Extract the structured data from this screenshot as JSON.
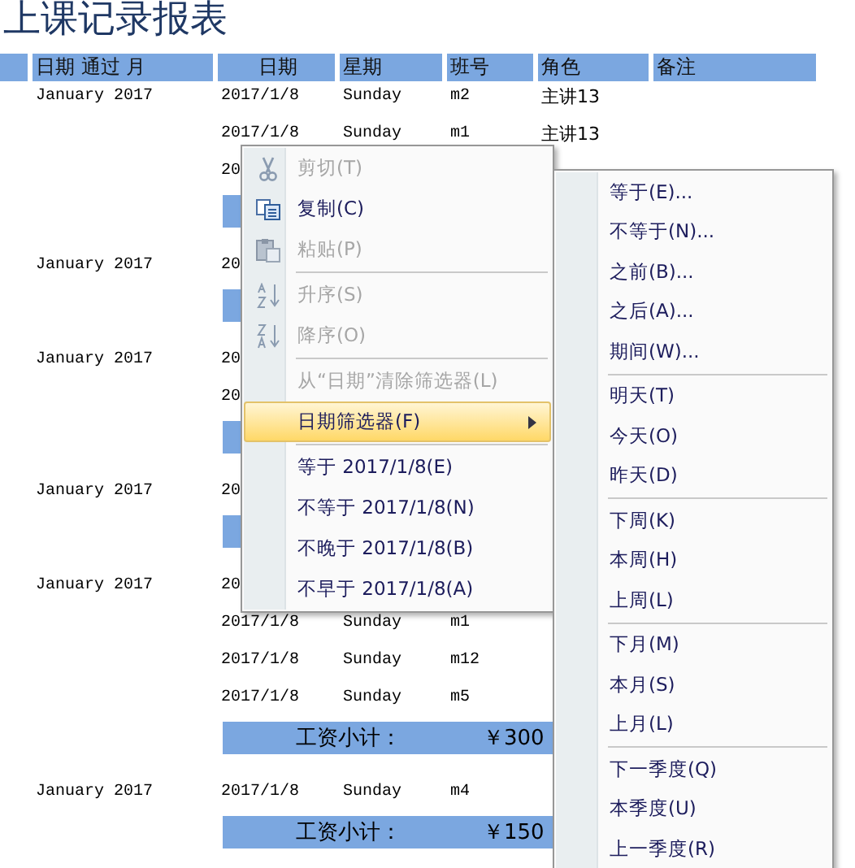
{
  "title": "上课记录报表",
  "columns": [
    {
      "label": "日期 通过 月"
    },
    {
      "label": "日期"
    },
    {
      "label": "星期"
    },
    {
      "label": "班号"
    },
    {
      "label": "角色"
    },
    {
      "label": "备注"
    }
  ],
  "groups": [
    {
      "month": "January 2017",
      "rows": [
        {
          "date": "2017/1/8",
          "day": "Sunday",
          "class": "m2",
          "role": "主讲13"
        },
        {
          "date": "2017/1/8",
          "day": "Sunday",
          "class": "m1",
          "role": "主讲13"
        },
        {
          "date": "20"
        }
      ],
      "has_subtotal": true
    },
    {
      "month": "January 2017",
      "rows": [
        {
          "date": "20"
        }
      ],
      "has_subtotal": true
    },
    {
      "month": "January 2017",
      "rows": [
        {
          "date": "20"
        },
        {
          "date": "20"
        }
      ],
      "has_subtotal": true
    },
    {
      "month": "January 2017",
      "rows": [
        {
          "date": "20"
        }
      ],
      "has_subtotal": true
    },
    {
      "month": "January 2017",
      "rows": [
        {
          "date": "20"
        },
        {
          "date": "2017/1/8",
          "day": "Sunday",
          "class": "m1"
        },
        {
          "date": "2017/1/8",
          "day": "Sunday",
          "class": "m12"
        },
        {
          "date": "2017/1/8",
          "day": "Sunday",
          "class": "m5"
        }
      ],
      "has_subtotal": true,
      "subtotal_label": "工资小计：",
      "subtotal_amount": "￥300"
    },
    {
      "month": "January 2017",
      "rows": [
        {
          "date": "2017/1/8",
          "day": "Sunday",
          "class": "m4"
        }
      ],
      "has_subtotal": true,
      "subtotal_label": "工资小计：",
      "subtotal_amount": "￥150"
    }
  ],
  "context_menu": {
    "items": [
      {
        "kind": "item",
        "label": "剪切(T)",
        "disabled": true,
        "selected": false
      },
      {
        "kind": "item",
        "label": "复制(C)",
        "disabled": false,
        "selected": false
      },
      {
        "kind": "item",
        "label": "粘贴(P)",
        "disabled": true,
        "selected": false
      },
      {
        "kind": "separator"
      },
      {
        "kind": "item",
        "label": "升序(S)",
        "disabled": true,
        "selected": false
      },
      {
        "kind": "item",
        "label": "降序(O)",
        "disabled": true,
        "selected": false
      },
      {
        "kind": "separator"
      },
      {
        "kind": "item",
        "label": "从“日期”清除筛选器(L)",
        "disabled": true,
        "selected": false
      },
      {
        "kind": "item",
        "label": "日期筛选器(F)",
        "disabled": false,
        "selected": true,
        "has_submenu": true
      },
      {
        "kind": "separator"
      },
      {
        "kind": "item",
        "label": "等于 2017/1/8(E)",
        "disabled": false,
        "selected": false
      },
      {
        "kind": "item",
        "label": "不等于 2017/1/8(N)",
        "disabled": false,
        "selected": false
      },
      {
        "kind": "item",
        "label": "不晚于 2017/1/8(B)",
        "disabled": false,
        "selected": false
      },
      {
        "kind": "item",
        "label": "不早于 2017/1/8(A)",
        "disabled": false,
        "selected": false
      }
    ]
  },
  "submenu": {
    "items": [
      {
        "kind": "item",
        "label": "等于(E)...",
        "selected": false
      },
      {
        "kind": "item",
        "label": "不等于(N)...",
        "selected": false
      },
      {
        "kind": "item",
        "label": "之前(B)...",
        "selected": false
      },
      {
        "kind": "item",
        "label": "之后(A)...",
        "selected": false
      },
      {
        "kind": "item",
        "label": "期间(W)...",
        "selected": false
      },
      {
        "kind": "separator"
      },
      {
        "kind": "item",
        "label": "明天(T)",
        "selected": false
      },
      {
        "kind": "item",
        "label": "今天(O)",
        "selected": false
      },
      {
        "kind": "item",
        "label": "昨天(D)",
        "selected": false
      },
      {
        "kind": "separator"
      },
      {
        "kind": "item",
        "label": "下周(K)",
        "selected": false
      },
      {
        "kind": "item",
        "label": "本周(H)",
        "selected": false
      },
      {
        "kind": "item",
        "label": "上周(L)",
        "selected": false
      },
      {
        "kind": "separator"
      },
      {
        "kind": "item",
        "label": "下月(M)",
        "selected": false
      },
      {
        "kind": "item",
        "label": "本月(S)",
        "selected": false
      },
      {
        "kind": "item",
        "label": "上月(L)",
        "selected": false
      },
      {
        "kind": "separator"
      },
      {
        "kind": "item",
        "label": "下一季度(Q)",
        "selected": false
      },
      {
        "kind": "item",
        "label": "本季度(U)",
        "selected": false
      },
      {
        "kind": "item",
        "label": "上一季度(R)",
        "selected": false
      }
    ]
  }
}
